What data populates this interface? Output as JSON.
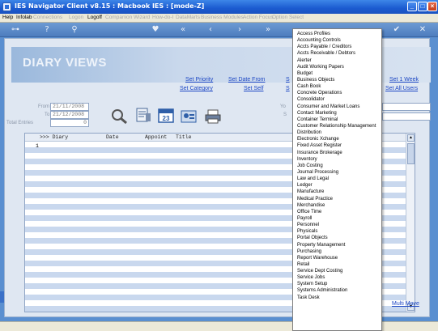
{
  "window": {
    "title": "IES Navigator Client v8.15 : Macbook IES :     [mode-Z]"
  },
  "menubar": {
    "items": [
      "Help",
      "Infolab",
      "Connections",
      "Logon",
      "Logoff",
      "Companion",
      "Wizard",
      "How-do-I",
      "DataMarts",
      "Business Modules",
      "Action Focus",
      "Option Select"
    ]
  },
  "toolbar": {
    "icons": [
      "key-icon",
      "help-icon",
      "search-icon",
      "heart-icon",
      "rewind-icon",
      "back-icon",
      "forward-icon",
      "fast-forward-icon",
      "check-icon",
      "close-icon"
    ]
  },
  "page": {
    "heading": "DIARY VIEWS",
    "links": {
      "set_priority": "Set Priority",
      "set_category": "Set Category",
      "set_date_from": "Set Date From",
      "set_self": "Set Self",
      "set_1_week": "Set 1 Week",
      "set_all_users": "Set All Users",
      "multi_move": "Multi Move",
      "hidden_s1": "S",
      "hidden_s2": "S"
    },
    "fields": {
      "from_label": "From",
      "from_value": "21/11/2008",
      "to_label": "To",
      "to_value": "21/12/2008",
      "total_label": "Total Entries",
      "total_value": "0",
      "side_label1": "Yo",
      "side_label2": "S"
    }
  },
  "grid": {
    "columns": [
      ">>> Diary",
      "Date",
      "Appoint",
      "Title"
    ],
    "row_number": "1"
  },
  "dropdown": {
    "items": [
      "Access Profiles",
      "Accounting Controls",
      "Accts Payable / Creditors",
      "Accts Receivable / Debtors",
      "Alerter",
      "Audit Working Papers",
      "Budget",
      "Business Objects",
      "Cash Book",
      "Concrete Operations",
      "Consolidator",
      "Consumer and Market Loans",
      "Contact Marketing",
      "Container Terminal",
      "Customer Relationship Management",
      "Distribution",
      "Electronic Xchange",
      "Fixed Asset Register",
      "Insurance Brokerage",
      "Inventory",
      "Job Costing",
      "Journal Processing",
      "Law and Legal",
      "Ledger",
      "Manufacture",
      "Medical Practice",
      "Merchandise",
      "Office Time",
      "Payroll",
      "Personnel",
      "Physicals",
      "Portal Objects",
      "Property Management",
      "Purchasing",
      "Report Warehouse",
      "Retail",
      "Service Dept Costing",
      "Service Jobs",
      "System Setup",
      "Systems Administration",
      "Task Desk"
    ]
  }
}
